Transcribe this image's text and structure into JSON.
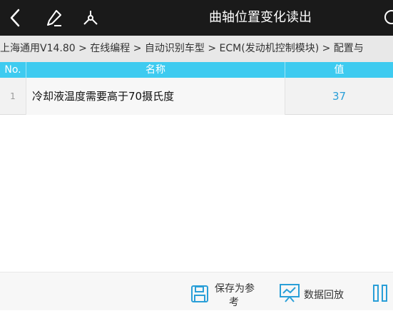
{
  "header": {
    "title": "曲轴位置变化读出",
    "icons": [
      "back-icon",
      "edit-icon",
      "share-icon"
    ]
  },
  "breadcrumb": "上海通用V14.80 > 在线编程 > 自动识别车型 > ECM(发动机控制模块) > 配置与",
  "table": {
    "columns": [
      "No.",
      "名称",
      "值"
    ],
    "rows": [
      {
        "no": "1",
        "name": "冷却液温度需要高于70摄氏度",
        "value": "37"
      }
    ]
  },
  "footer": {
    "save_label_line1": "保存为参",
    "save_label_line2": "考",
    "playback_label": "数据回放"
  },
  "colors": {
    "header_bg": "#1a1a1a",
    "table_header_bg": "#3ecbf0",
    "accent": "#2a9fd8"
  }
}
